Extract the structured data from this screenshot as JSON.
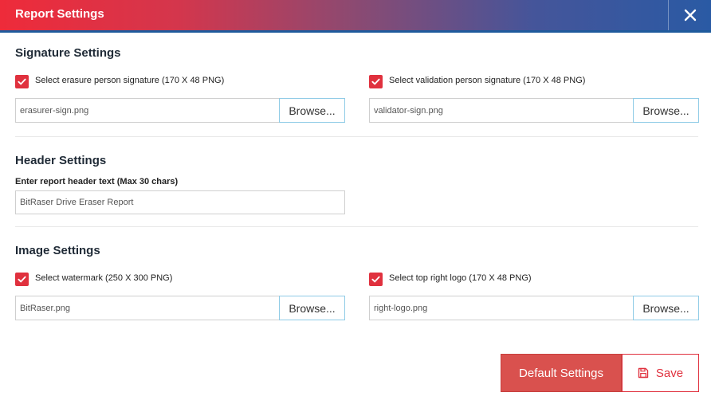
{
  "dialog": {
    "title": "Report Settings",
    "close_icon": "close-icon"
  },
  "signature": {
    "section_title": "Signature Settings",
    "erasure": {
      "checked": true,
      "label": "Select erasure person signature (170 X 48 PNG)",
      "file_value": "erasurer-sign.png",
      "browse_label": "Browse..."
    },
    "validation": {
      "checked": true,
      "label": "Select validation person signature (170 X 48 PNG)",
      "file_value": "validator-sign.png",
      "browse_label": "Browse..."
    }
  },
  "header": {
    "section_title": "Header Settings",
    "field_label": "Enter report header text (Max 30 chars)",
    "field_value": "BitRaser Drive Eraser Report"
  },
  "image": {
    "section_title": "Image Settings",
    "watermark": {
      "checked": true,
      "label": "Select watermark (250 X 300 PNG)",
      "file_value": "BitRaser.png",
      "browse_label": "Browse..."
    },
    "logo": {
      "checked": true,
      "label": "Select top right logo (170 X 48 PNG)",
      "file_value": "right-logo.png",
      "browse_label": "Browse..."
    }
  },
  "footer": {
    "default_label": "Default Settings",
    "save_label": "Save",
    "save_icon": "floppy-disk-icon"
  },
  "colors": {
    "accent_red": "#e0313e",
    "title_gradient_start": "#ee2b3a",
    "title_gradient_end": "#2a5aa4",
    "default_button": "#d9514e",
    "browse_border": "#8fcbe6"
  }
}
